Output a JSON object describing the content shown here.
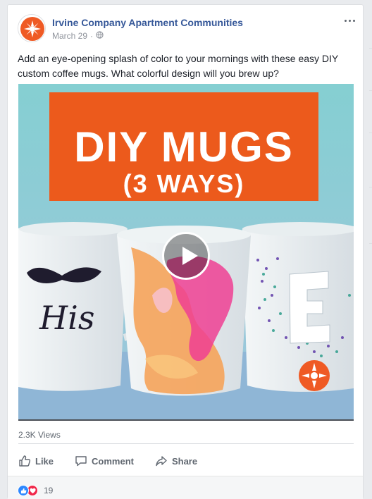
{
  "post": {
    "page_name": "Irvine Company Apartment Communities",
    "date": "March 29",
    "separator": "·",
    "privacy_icon": "globe-icon",
    "more_icon": "more-options-icon",
    "text": "Add an eye-opening splash of color to your mornings with these easy DIY custom coffee mugs. What colorful design will you brew up?"
  },
  "video": {
    "title_line1": "DIY MUGS",
    "title_line2": "(3 WAYS)",
    "mug_left_text": "His",
    "mug_right_letter": "E",
    "play_icon": "play-icon",
    "views": "2.3K Views"
  },
  "actions": {
    "like_label": "Like",
    "comment_label": "Comment",
    "share_label": "Share"
  },
  "reactions": {
    "count": "19",
    "icons": [
      "like-reaction-icon",
      "love-reaction-icon"
    ]
  },
  "colors": {
    "link_blue": "#365899",
    "title_orange": "#ec5a1c",
    "background_teal": "#7ec8cc",
    "like_blue": "#2d88ff",
    "love_red": "#f0284a"
  }
}
